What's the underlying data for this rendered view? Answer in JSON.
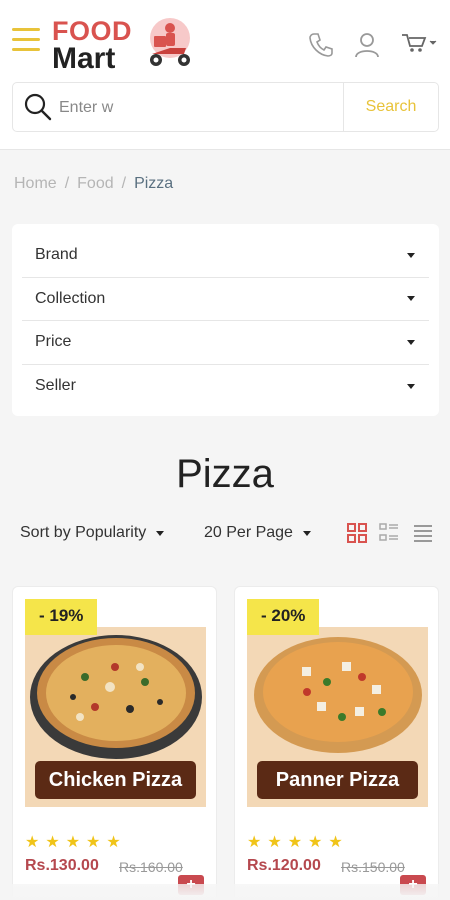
{
  "header": {
    "logo_top": "FOOD",
    "logo_bottom": "Mart",
    "icons": [
      "menu-icon",
      "phone-icon",
      "user-icon",
      "cart-icon"
    ]
  },
  "search": {
    "placeholder": "Enter w",
    "button_label": "Search"
  },
  "breadcrumb": {
    "items": [
      "Home",
      "Food",
      "Pizza"
    ],
    "separator": "/"
  },
  "filters": {
    "items": [
      {
        "label": "Brand"
      },
      {
        "label": "Collection"
      },
      {
        "label": "Price"
      },
      {
        "label": "Seller"
      }
    ]
  },
  "page": {
    "title": "Pizza"
  },
  "toolbar": {
    "sort_label": "Sort by Popularity",
    "per_page_label": "20 Per Page",
    "view_icons": [
      "grid-large-icon",
      "grid-small-icon",
      "list-icon"
    ]
  },
  "products": [
    {
      "discount": "- 19%",
      "name": "Chicken Pizza",
      "rating": 5,
      "price": "Rs.130.00",
      "old_price": "Rs.160.00"
    },
    {
      "discount": "- 20%",
      "name": "Panner Pizza",
      "rating": 5,
      "price": "Rs.120.00",
      "old_price": "Rs.150.00"
    }
  ],
  "colors": {
    "accent_yellow": "#e8c33a",
    "badge_yellow": "#f5e54a",
    "price_red": "#b5484e",
    "logo_red": "#d9534f",
    "label_brown": "#5b2a15"
  }
}
